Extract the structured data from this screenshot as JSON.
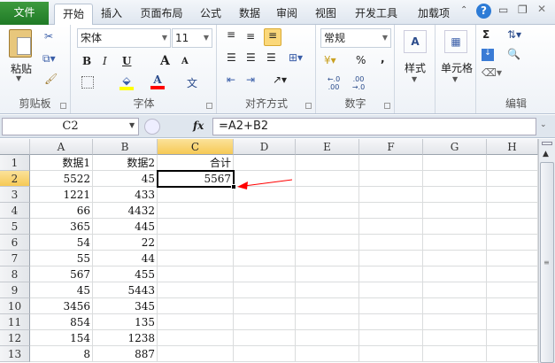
{
  "tabs": [
    "文件",
    "开始",
    "插入",
    "页面布局",
    "公式",
    "数据",
    "审阅",
    "视图",
    "开发工具",
    "加载项"
  ],
  "ribbon": {
    "clipboard": {
      "label": "剪贴板",
      "paste": "粘贴"
    },
    "font": {
      "label": "字体",
      "name": "宋体",
      "size": "11",
      "bold": "B",
      "italic": "I",
      "underline": "U",
      "grow": "A",
      "shrink": "A",
      "font_color_glyph": "A",
      "phonetic": "文",
      "fill_color": "#ffff00",
      "font_color": "#ff0000"
    },
    "alignment": {
      "label": "对齐方式"
    },
    "number": {
      "label": "数字",
      "format": "常规",
      "percent": "%",
      "comma": ",",
      "inc_decimal": "←.0 .00",
      "dec_decimal": ".00 →.0"
    },
    "styles": {
      "label": "样式"
    },
    "cells": {
      "label": "单元格"
    },
    "editing": {
      "label": "编辑",
      "sum": "Σ"
    }
  },
  "formula_bar": {
    "name_box": "C2",
    "fx": "fx",
    "formula": "=A2+B2"
  },
  "columns": [
    "A",
    "B",
    "C",
    "D",
    "E",
    "F",
    "G",
    "H"
  ],
  "selected_cell": "C2",
  "rows": [
    {
      "n": "1",
      "a": "数据1",
      "b": "数据2",
      "c": "合计"
    },
    {
      "n": "2",
      "a": "5522",
      "b": "45",
      "c": "5567"
    },
    {
      "n": "3",
      "a": "1221",
      "b": "433",
      "c": ""
    },
    {
      "n": "4",
      "a": "66",
      "b": "4432",
      "c": ""
    },
    {
      "n": "5",
      "a": "365",
      "b": "445",
      "c": ""
    },
    {
      "n": "6",
      "a": "54",
      "b": "22",
      "c": ""
    },
    {
      "n": "7",
      "a": "55",
      "b": "44",
      "c": ""
    },
    {
      "n": "8",
      "a": "567",
      "b": "455",
      "c": ""
    },
    {
      "n": "9",
      "a": "45",
      "b": "5443",
      "c": ""
    },
    {
      "n": "10",
      "a": "3456",
      "b": "345",
      "c": ""
    },
    {
      "n": "11",
      "a": "854",
      "b": "135",
      "c": ""
    },
    {
      "n": "12",
      "a": "154",
      "b": "1238",
      "c": ""
    },
    {
      "n": "13",
      "a": "8",
      "b": "887",
      "c": ""
    }
  ],
  "annotation_color": "#ff0000"
}
